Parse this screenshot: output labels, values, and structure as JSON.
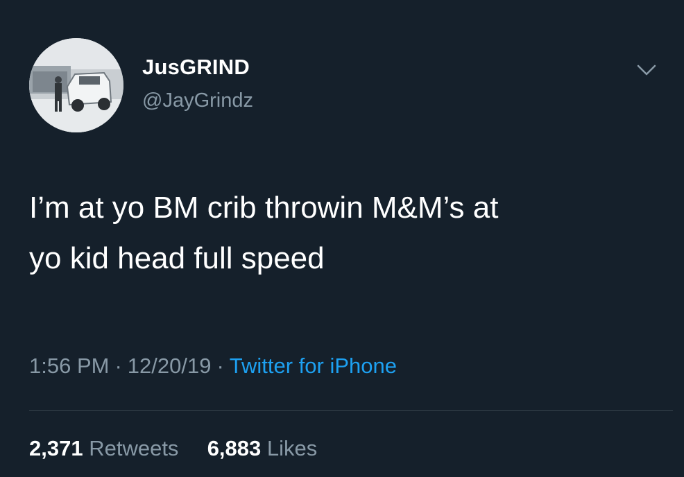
{
  "theme": {
    "background": "#15202b",
    "primary_text": "#ffffff",
    "secondary_text": "#8899a6",
    "link": "#1da1f2",
    "divider": "#38444d"
  },
  "author": {
    "display_name": "JusGRIND",
    "handle": "@JayGrindz",
    "avatar_icon": "profile-photo-person-with-truck"
  },
  "menu": {
    "icon": "chevron-down-icon"
  },
  "tweet": {
    "lines": [
      "I’m at yo BM crib throwin M&M’s at",
      "yo kid head full speed"
    ],
    "time": "1:56 PM",
    "date": "12/20/19",
    "separator": "·",
    "source": "Twitter for iPhone"
  },
  "stats": {
    "retweets_count": "2,371",
    "retweets_label": "Retweets",
    "likes_count": "6,883",
    "likes_label": "Likes"
  }
}
